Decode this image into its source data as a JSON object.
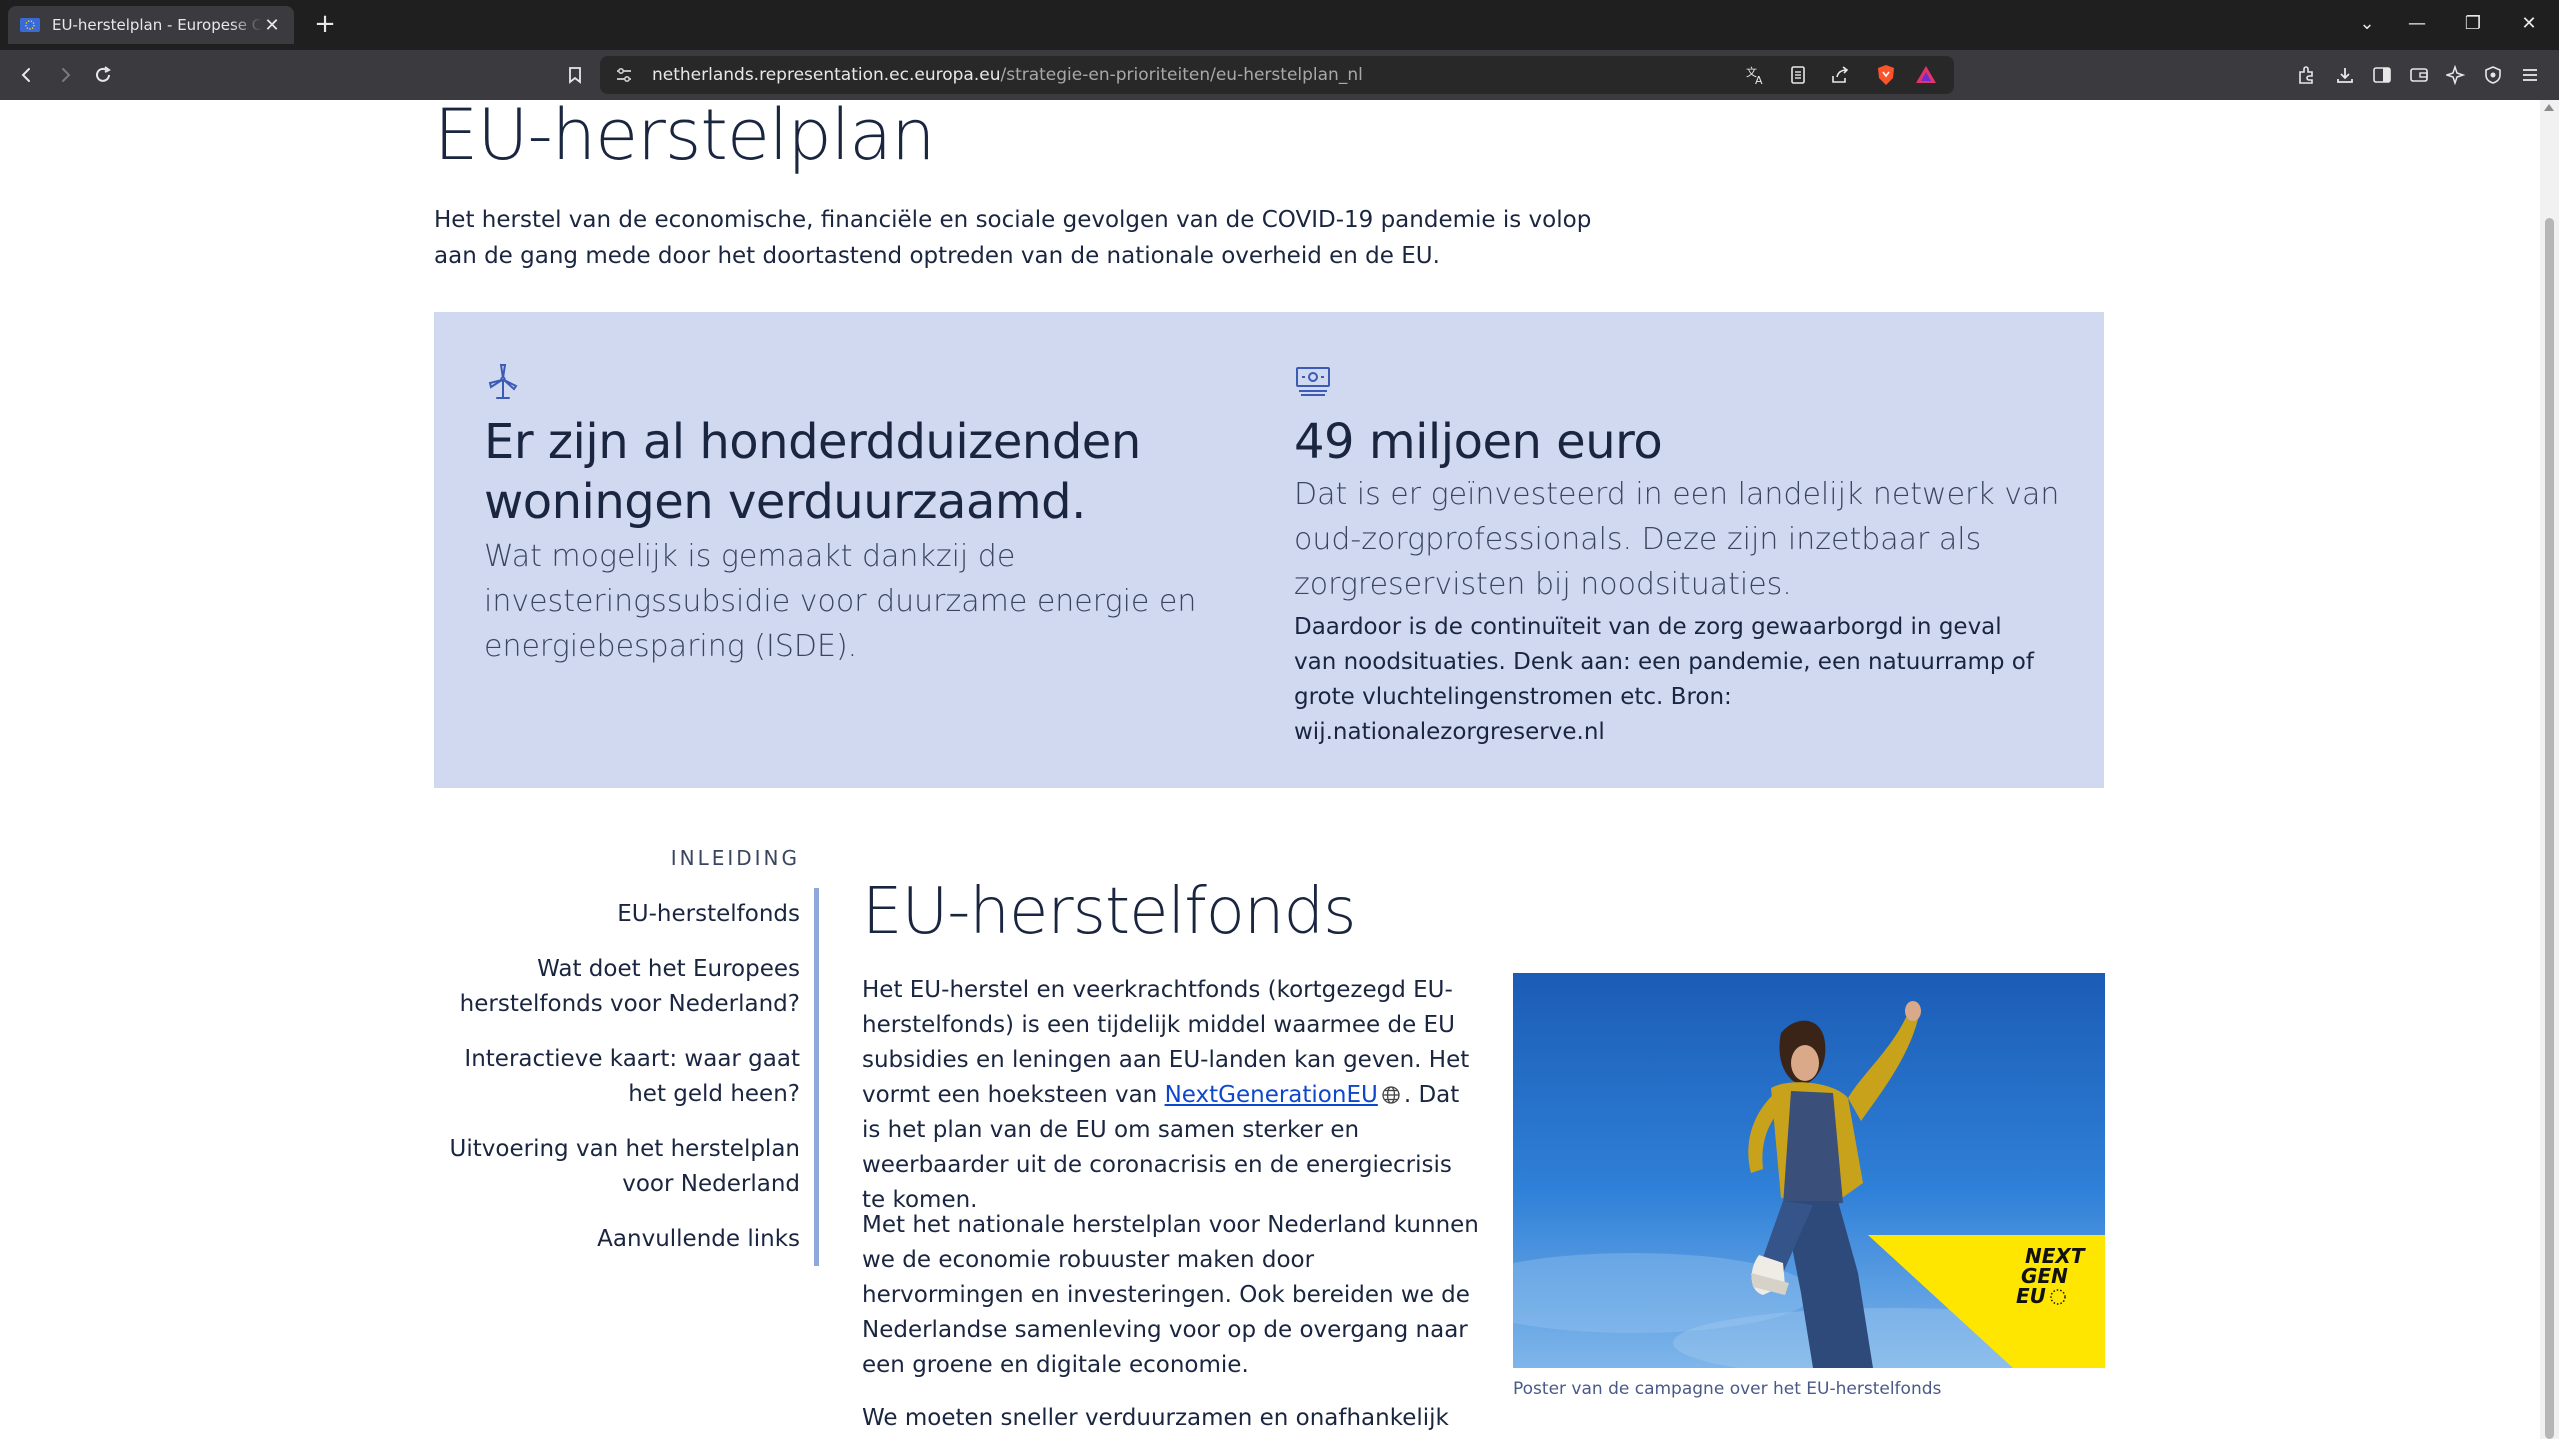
{
  "browser": {
    "tab_title": "EU-herstelplan - Europese Commissie",
    "new_tab_symbol": "+",
    "close_symbol": "✕",
    "url_host": "netherlands.representation.ec.europa.eu",
    "url_path": "/strategie-en-prioriteiten/eu-herstelplan_nl",
    "window_controls": [
      "⌄",
      "—",
      "❐",
      "✕"
    ]
  },
  "page": {
    "title": "EU-herstelplan",
    "intro": "Het herstel van de economische, financiële en sociale gevolgen van de COVID-19 pandemie is volop aan de gang mede door het doortastend optreden van de nationale overheid en de EU.",
    "stats": [
      {
        "icon": "wind-turbine-icon",
        "heading": "Er zijn al honderdduizenden woningen verduurzaamd.",
        "subtext": "Wat mogelijk is gemaakt dankzij de investeringssubsidie voor duurzame energie en energiebesparing (ISDE).",
        "note": ""
      },
      {
        "icon": "money-icon",
        "heading": "49 miljoen euro",
        "subtext": "Dat is er geïnvesteerd in een landelijk netwerk van oud-zorgprofessionals. Deze zijn inzetbaar als zorgreservisten bij noodsituaties.",
        "note": "Daardoor is de continuïteit van de zorg gewaarborgd in geval van noodsituaties. Denk aan: een pandemie, een natuurramp of grote vluchtelingenstromen etc. Bron: wij.nationalezorgreserve.nl"
      }
    ],
    "toc": {
      "label": "INLEIDING",
      "items": [
        "EU-herstelfonds",
        "Wat doet het Europees herstelfonds voor Nederland?",
        "Interactieve kaart: waar gaat het geld heen?",
        "Uitvoering van het herstelplan voor Nederland",
        "Aanvullende links"
      ]
    },
    "section_title": "EU-herstelfonds",
    "para1_before": "Het EU-herstel en veerkrachtfonds (kortgezegd EU-herstelfonds) is een tijdelijk middel waarmee de EU subsidies en leningen aan EU-landen kan geven. Het vormt een hoeksteen van ",
    "para1_link": "NextGenerationEU",
    "para1_after": ". Dat is het plan van de EU om samen sterker en weerbaarder uit de coronacrisis en de energiecrisis te komen.",
    "para2": "Met het nationale herstelplan voor Nederland kunnen we de economie robuuster maken door hervormingen en investeringen. Ook bereiden we de Nederlandse samenleving voor op de overgang naar een groene en digitale economie.",
    "para3": "We moeten sneller verduurzamen en onafhankelijk worden",
    "poster_caption": "Poster van de campagne over het EU-herstelfonds",
    "poster_logo": [
      "NEXT",
      "GEN",
      "EU"
    ]
  },
  "colors": {
    "stats_bg": "#d0d9f0",
    "text": "#1a2540",
    "link": "#0e47cb",
    "toc_bar": "#8ea8db",
    "logo_yellow": "#ffe600"
  }
}
